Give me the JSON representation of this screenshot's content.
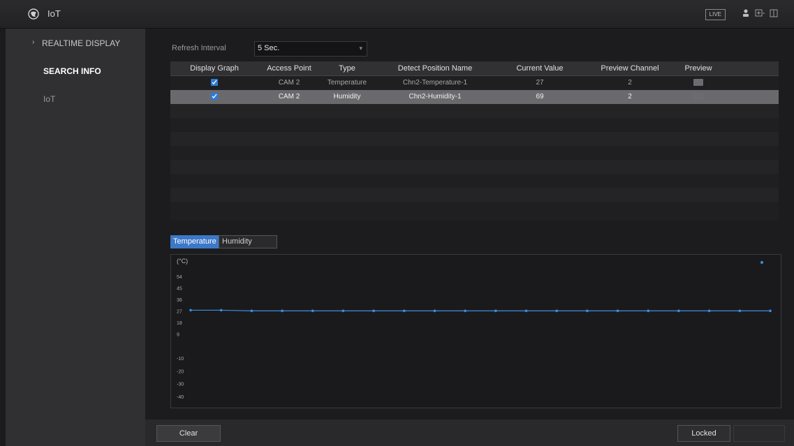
{
  "app": {
    "title": "IoT",
    "live_label": "LIVE"
  },
  "header_icons": [
    "user-icon",
    "add-icon",
    "tile-icon"
  ],
  "sidebar": {
    "items": [
      {
        "label": "REALTIME DISPLAY",
        "state": "expanded"
      },
      {
        "label": "SEARCH INFO",
        "state": "active"
      },
      {
        "label": "IoT",
        "state": "normal"
      }
    ]
  },
  "refresh": {
    "label": "Refresh Interval",
    "value": "5 Sec."
  },
  "table": {
    "headers": [
      "Display Graph",
      "Access Point",
      "Type",
      "Detect Position Name",
      "Current Value",
      "Preview Channel",
      "Preview"
    ],
    "rows": [
      {
        "checked": true,
        "access_point": "CAM 2",
        "type": "Temperature",
        "name": "Chn2-Temperature-1",
        "value": "27",
        "channel": "2",
        "selected": false
      },
      {
        "checked": true,
        "access_point": "CAM 2",
        "type": "Humidity",
        "name": "Chn2-Humidity-1",
        "value": "69",
        "channel": "2",
        "selected": true
      }
    ]
  },
  "tabs": {
    "temperature": "Temperature",
    "humidity": "Humidity"
  },
  "chart_data": {
    "type": "line",
    "title": "",
    "ylabel": "(°C)",
    "yticks": [
      "54",
      "45",
      "36",
      "27",
      "18",
      "9",
      "-10",
      "-20",
      "-30",
      "-40"
    ],
    "ylim": [
      -45,
      60
    ],
    "grid": false,
    "series": [
      {
        "color": "#3d8de0",
        "values": [
          27.5,
          27.5,
          27,
          27,
          27,
          27,
          27,
          27,
          27,
          27,
          27,
          27,
          27,
          27,
          27,
          27,
          27,
          27,
          27,
          27
        ]
      }
    ],
    "marker_color": "#3d8de0"
  },
  "footer": {
    "clear_label": "Clear",
    "locked_label": "Locked"
  }
}
